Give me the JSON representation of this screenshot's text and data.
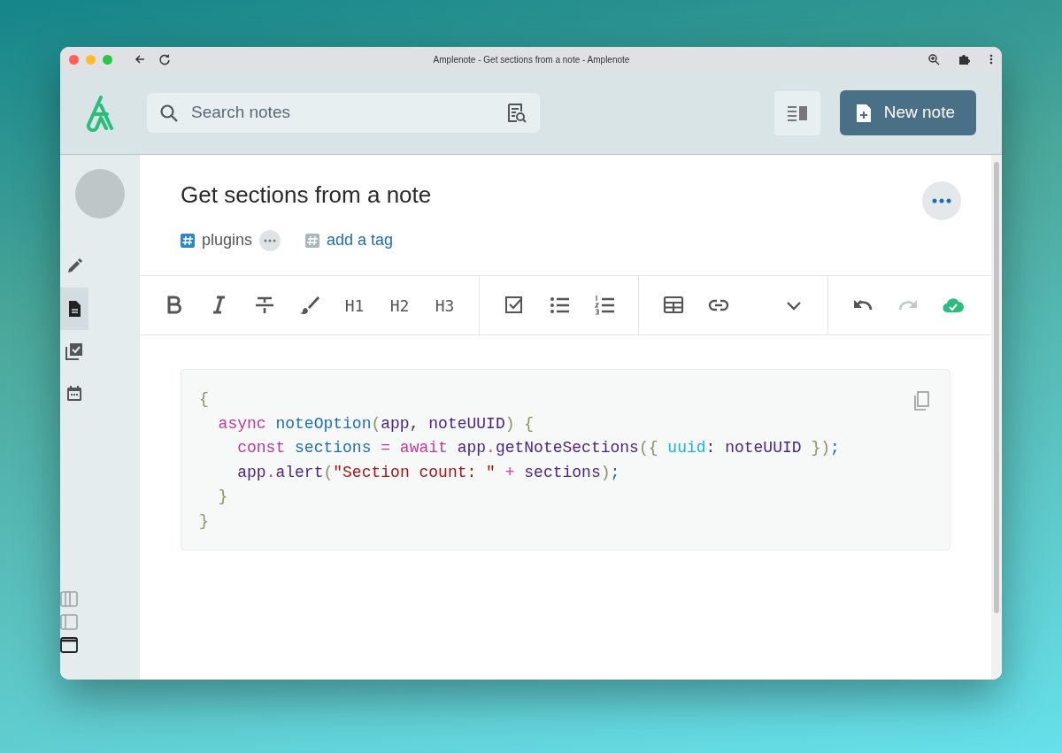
{
  "window": {
    "title": "Amplenote - Get sections from a note - Amplenote"
  },
  "search": {
    "placeholder": "Search notes"
  },
  "new_note_button": {
    "label": "New note"
  },
  "sidebar": {
    "items": [
      {
        "selected": false
      },
      {
        "selected": true
      },
      {
        "selected": false
      },
      {
        "selected": false
      }
    ],
    "layout_buttons": [
      {
        "selected": false
      },
      {
        "selected": false
      },
      {
        "selected": true
      }
    ]
  },
  "note": {
    "title": "Get sections from a note",
    "tags": [
      {
        "label": "plugins"
      }
    ],
    "add_tag": "add a tag"
  },
  "toolbar": {
    "groups": [
      [
        {
          "kind": "bold",
          "disabled": false
        },
        {
          "kind": "italic",
          "disabled": false
        },
        {
          "kind": "strike",
          "disabled": false
        },
        {
          "kind": "brush",
          "disabled": false
        },
        {
          "kind": "text",
          "label": "H1",
          "disabled": false
        },
        {
          "kind": "text",
          "label": "H2",
          "disabled": false
        },
        {
          "kind": "text",
          "label": "H3",
          "disabled": false
        }
      ],
      [
        {
          "kind": "task",
          "disabled": false
        },
        {
          "kind": "bullets",
          "disabled": false
        },
        {
          "kind": "numbers",
          "disabled": false
        }
      ],
      [
        {
          "kind": "table",
          "disabled": false
        },
        {
          "kind": "link",
          "disabled": false
        },
        {
          "kind": "spacer"
        },
        {
          "kind": "chevron",
          "disabled": false
        }
      ],
      [
        {
          "kind": "undo",
          "disabled": false
        },
        {
          "kind": "redo",
          "disabled": true
        },
        {
          "kind": "saved"
        }
      ]
    ]
  },
  "code": {
    "lines": [
      [
        {
          "text": "{",
          "kind": "punct"
        }
      ],
      [
        {
          "text": "  async ",
          "kind": "keyword"
        },
        {
          "text": "noteOption",
          "kind": "fn"
        },
        {
          "text": "(",
          "kind": "punct"
        },
        {
          "text": "app, noteUUID",
          "kind": "var"
        },
        {
          "text": ") {",
          "kind": "punct"
        }
      ],
      [
        {
          "text": "    const ",
          "kind": "keyword"
        },
        {
          "text": "sections ",
          "kind": "fn"
        },
        {
          "text": "= await ",
          "kind": "keyword"
        },
        {
          "text": "app",
          "kind": "var"
        },
        {
          "text": ".",
          "kind": "op"
        },
        {
          "text": "getNoteSections",
          "kind": "var"
        },
        {
          "text": "({ ",
          "kind": "punct"
        },
        {
          "text": "uuid",
          "kind": "prop"
        },
        {
          "text": ": noteUUID ",
          "kind": "var"
        },
        {
          "text": "})",
          "kind": "punct"
        },
        {
          "text": ";",
          "kind": "semi"
        }
      ],
      [
        {
          "text": "    app",
          "kind": "var"
        },
        {
          "text": ".",
          "kind": "op"
        },
        {
          "text": "alert",
          "kind": "var"
        },
        {
          "text": "(",
          "kind": "punct"
        },
        {
          "text": "\"Section count: \"",
          "kind": "string"
        },
        {
          "text": " + ",
          "kind": "op"
        },
        {
          "text": "sections",
          "kind": "var"
        },
        {
          "text": ")",
          "kind": "punct"
        },
        {
          "text": ";",
          "kind": "semi"
        }
      ],
      [
        {
          "text": "  }",
          "kind": "punct"
        }
      ],
      [
        {
          "text": "}",
          "kind": "punct"
        }
      ]
    ]
  }
}
